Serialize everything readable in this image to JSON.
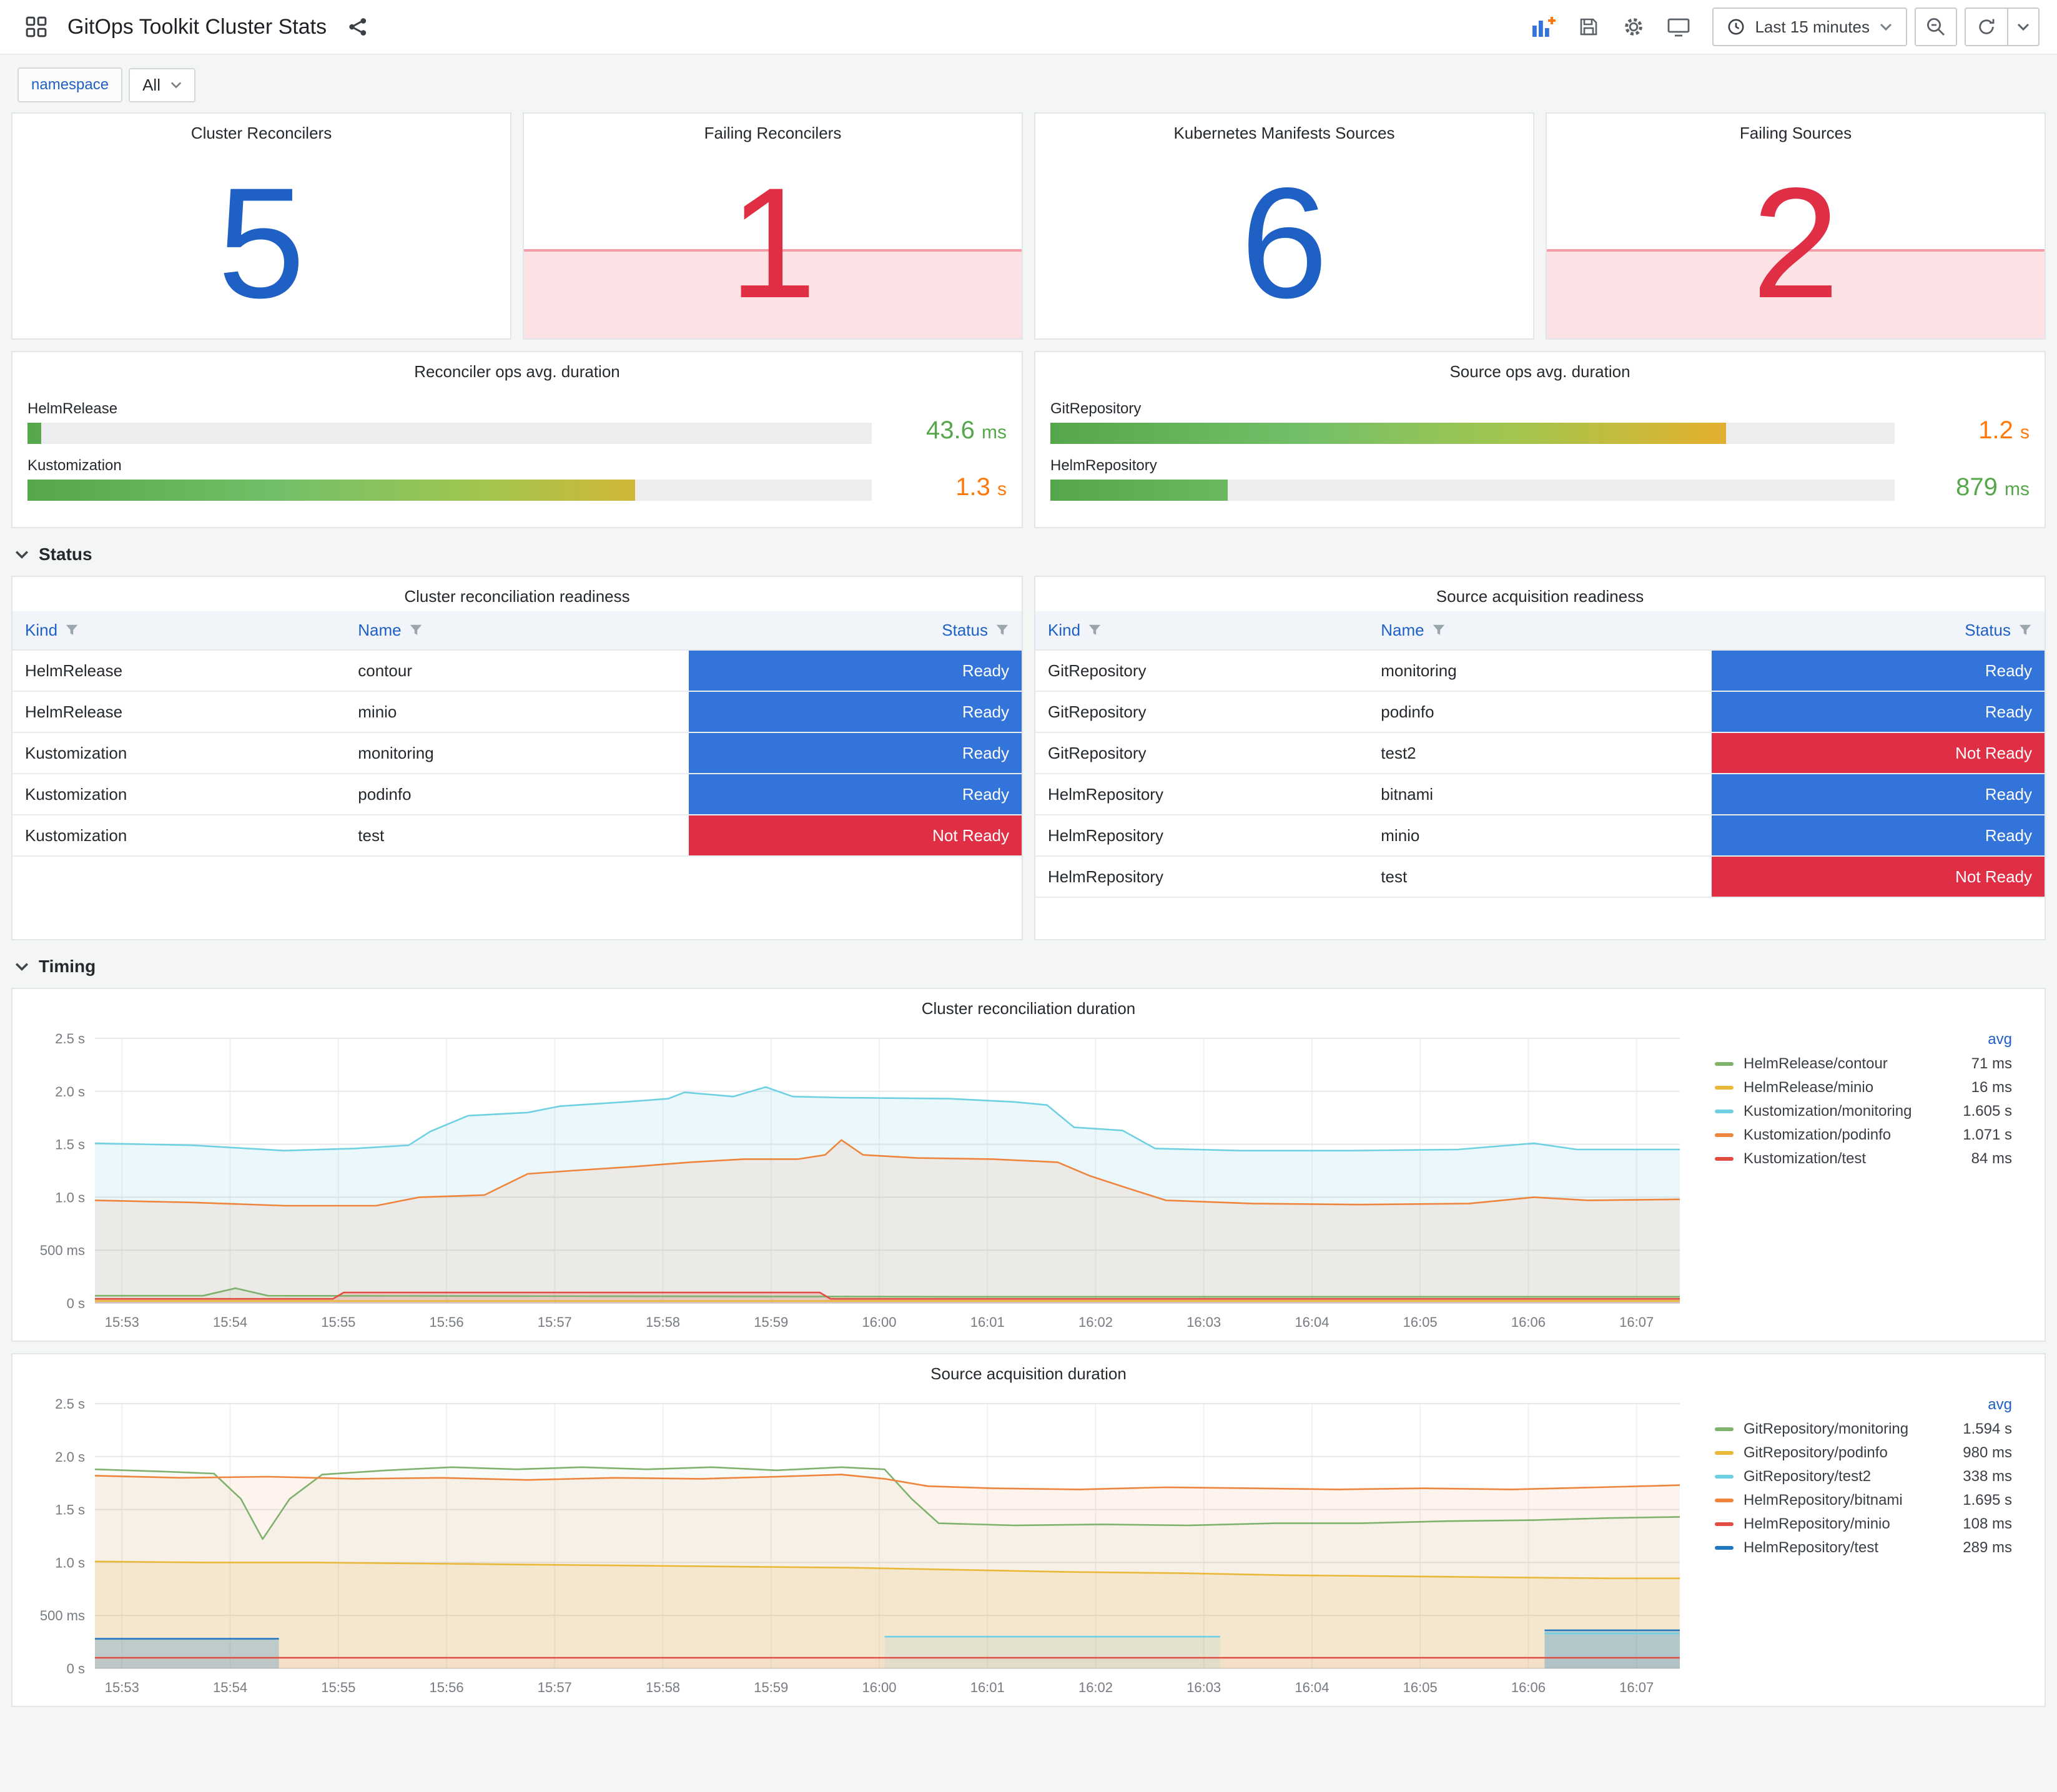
{
  "header": {
    "title": "GitOps Toolkit Cluster Stats",
    "time_range": "Last 15 minutes"
  },
  "variables": {
    "label": "namespace",
    "value": "All"
  },
  "stats": [
    {
      "title": "Cluster Reconcilers",
      "value": "5",
      "color": "#1F60C4"
    },
    {
      "title": "Failing Reconcilers",
      "value": "1",
      "color": "#E02F44",
      "alert": true
    },
    {
      "title": "Kubernetes Manifests Sources",
      "value": "6",
      "color": "#1F60C4"
    },
    {
      "title": "Failing Sources",
      "value": "2",
      "color": "#E02F44",
      "alert": true
    }
  ],
  "gauge_panels": [
    {
      "title": "Reconciler ops avg. duration",
      "rows": [
        {
          "label": "HelmRelease",
          "value": "43.6",
          "unit": "ms",
          "pct": 1.6,
          "value_color": "#56A64B"
        },
        {
          "label": "Kustomization",
          "value": "1.3",
          "unit": "s",
          "pct": 72,
          "value_color": "#FF780A"
        }
      ]
    },
    {
      "title": "Source ops avg. duration",
      "rows": [
        {
          "label": "GitRepository",
          "value": "1.2",
          "unit": "s",
          "pct": 80,
          "value_color": "#FF780A"
        },
        {
          "label": "HelmRepository",
          "value": "879",
          "unit": "ms",
          "pct": 21,
          "value_color": "#56A64B"
        }
      ]
    }
  ],
  "sections": {
    "status": "Status",
    "timing": "Timing"
  },
  "tables": [
    {
      "title": "Cluster reconciliation readiness",
      "columns": [
        "Kind",
        "Name",
        "Status"
      ],
      "rows": [
        {
          "kind": "HelmRelease",
          "name": "contour",
          "status": "Ready",
          "color": "#3274D9"
        },
        {
          "kind": "HelmRelease",
          "name": "minio",
          "status": "Ready",
          "color": "#3274D9"
        },
        {
          "kind": "Kustomization",
          "name": "monitoring",
          "status": "Ready",
          "color": "#3274D9"
        },
        {
          "kind": "Kustomization",
          "name": "podinfo",
          "status": "Ready",
          "color": "#3274D9"
        },
        {
          "kind": "Kustomization",
          "name": "test",
          "status": "Not Ready",
          "color": "#E02F44"
        }
      ]
    },
    {
      "title": "Source acquisition readiness",
      "columns": [
        "Kind",
        "Name",
        "Status"
      ],
      "rows": [
        {
          "kind": "GitRepository",
          "name": "monitoring",
          "status": "Ready",
          "color": "#3274D9"
        },
        {
          "kind": "GitRepository",
          "name": "podinfo",
          "status": "Ready",
          "color": "#3274D9"
        },
        {
          "kind": "GitRepository",
          "name": "test2",
          "status": "Not Ready",
          "color": "#E02F44"
        },
        {
          "kind": "HelmRepository",
          "name": "bitnami",
          "status": "Ready",
          "color": "#3274D9"
        },
        {
          "kind": "HelmRepository",
          "name": "minio",
          "status": "Ready",
          "color": "#3274D9"
        },
        {
          "kind": "HelmRepository",
          "name": "test",
          "status": "Not Ready",
          "color": "#E02F44"
        }
      ]
    }
  ],
  "chart_data": [
    {
      "type": "line",
      "title": "Cluster reconciliation duration",
      "legend_header": "avg",
      "ylim": [
        0,
        2.5
      ],
      "xlim": [
        0,
        14.65
      ],
      "yticks": [
        {
          "v": 0,
          "label": "0 s"
        },
        {
          "v": 0.5,
          "label": "500 ms"
        },
        {
          "v": 1,
          "label": "1.0 s"
        },
        {
          "v": 1.5,
          "label": "1.5 s"
        },
        {
          "v": 2,
          "label": "2.0 s"
        },
        {
          "v": 2.5,
          "label": "2.5 s"
        }
      ],
      "xticks": [
        {
          "v": 0.25,
          "label": "15:53"
        },
        {
          "v": 1.25,
          "label": "15:54"
        },
        {
          "v": 2.25,
          "label": "15:55"
        },
        {
          "v": 3.25,
          "label": "15:56"
        },
        {
          "v": 4.25,
          "label": "15:57"
        },
        {
          "v": 5.25,
          "label": "15:58"
        },
        {
          "v": 6.25,
          "label": "15:59"
        },
        {
          "v": 7.25,
          "label": "16:00"
        },
        {
          "v": 8.25,
          "label": "16:01"
        },
        {
          "v": 9.25,
          "label": "16:02"
        },
        {
          "v": 10.25,
          "label": "16:03"
        },
        {
          "v": 11.25,
          "label": "16:04"
        },
        {
          "v": 12.25,
          "label": "16:05"
        },
        {
          "v": 13.25,
          "label": "16:06"
        },
        {
          "v": 14.25,
          "label": "16:07"
        }
      ],
      "series": [
        {
          "name": "HelmRelease/contour",
          "avg": "71 ms",
          "color": "#7EB26D",
          "fill": 0.07,
          "points": [
            [
              0,
              0.07
            ],
            [
              1.0,
              0.07
            ],
            [
              1.3,
              0.14
            ],
            [
              1.6,
              0.07
            ],
            [
              8,
              0.06
            ],
            [
              14.65,
              0.06
            ]
          ]
        },
        {
          "name": "HelmRelease/minio",
          "avg": "16 ms",
          "color": "#EAB839",
          "fill": 0,
          "points": [
            [
              0,
              0.02
            ],
            [
              14.65,
              0.02
            ]
          ]
        },
        {
          "name": "Kustomization/monitoring",
          "avg": "1.605 s",
          "color": "#6ED0E0",
          "fill": 0.14,
          "points": [
            [
              0,
              1.51
            ],
            [
              0.9,
              1.49
            ],
            [
              1.75,
              1.44
            ],
            [
              2.4,
              1.46
            ],
            [
              2.9,
              1.49
            ],
            [
              3.1,
              1.62
            ],
            [
              3.45,
              1.77
            ],
            [
              4.0,
              1.8
            ],
            [
              4.3,
              1.86
            ],
            [
              4.9,
              1.9
            ],
            [
              5.3,
              1.93
            ],
            [
              5.45,
              1.99
            ],
            [
              5.9,
              1.95
            ],
            [
              6.2,
              2.04
            ],
            [
              6.45,
              1.95
            ],
            [
              6.9,
              1.94
            ],
            [
              7.9,
              1.93
            ],
            [
              8.5,
              1.9
            ],
            [
              8.8,
              1.87
            ],
            [
              9.05,
              1.66
            ],
            [
              9.5,
              1.63
            ],
            [
              9.8,
              1.46
            ],
            [
              10.6,
              1.44
            ],
            [
              11.6,
              1.44
            ],
            [
              12.6,
              1.45
            ],
            [
              13.3,
              1.51
            ],
            [
              13.7,
              1.45
            ],
            [
              14.65,
              1.45
            ]
          ]
        },
        {
          "name": "Kustomization/podinfo",
          "avg": "1.071 s",
          "color": "#EF843C",
          "fill": 0.11,
          "points": [
            [
              0,
              0.97
            ],
            [
              0.9,
              0.95
            ],
            [
              1.75,
              0.92
            ],
            [
              2.6,
              0.92
            ],
            [
              3.0,
              1.0
            ],
            [
              3.6,
              1.02
            ],
            [
              4.0,
              1.22
            ],
            [
              4.4,
              1.25
            ],
            [
              5.0,
              1.29
            ],
            [
              5.5,
              1.33
            ],
            [
              6.0,
              1.36
            ],
            [
              6.5,
              1.36
            ],
            [
              6.75,
              1.4
            ],
            [
              6.9,
              1.54
            ],
            [
              7.1,
              1.4
            ],
            [
              7.6,
              1.37
            ],
            [
              8.3,
              1.36
            ],
            [
              8.9,
              1.33
            ],
            [
              9.2,
              1.2
            ],
            [
              9.5,
              1.1
            ],
            [
              9.9,
              0.97
            ],
            [
              10.7,
              0.94
            ],
            [
              11.7,
              0.93
            ],
            [
              12.7,
              0.94
            ],
            [
              13.3,
              1.0
            ],
            [
              13.8,
              0.97
            ],
            [
              14.65,
              0.98
            ]
          ]
        },
        {
          "name": "Kustomization/test",
          "avg": "84 ms",
          "color": "#E24D42",
          "fill": 0.18,
          "points": [
            [
              0,
              0.04
            ],
            [
              2.2,
              0.04
            ],
            [
              2.3,
              0.1
            ],
            [
              6.7,
              0.1
            ],
            [
              6.8,
              0.04
            ],
            [
              14.65,
              0.04
            ]
          ]
        }
      ]
    },
    {
      "type": "line",
      "title": "Source acquisition duration",
      "legend_header": "avg",
      "ylim": [
        0,
        2.5
      ],
      "xlim": [
        0,
        14.65
      ],
      "yticks": [
        {
          "v": 0,
          "label": "0 s"
        },
        {
          "v": 0.5,
          "label": "500 ms"
        },
        {
          "v": 1,
          "label": "1.0 s"
        },
        {
          "v": 1.5,
          "label": "1.5 s"
        },
        {
          "v": 2,
          "label": "2.0 s"
        },
        {
          "v": 2.5,
          "label": "2.5 s"
        }
      ],
      "xticks": [
        {
          "v": 0.25,
          "label": "15:53"
        },
        {
          "v": 1.25,
          "label": "15:54"
        },
        {
          "v": 2.25,
          "label": "15:55"
        },
        {
          "v": 3.25,
          "label": "15:56"
        },
        {
          "v": 4.25,
          "label": "15:57"
        },
        {
          "v": 5.25,
          "label": "15:58"
        },
        {
          "v": 6.25,
          "label": "15:59"
        },
        {
          "v": 7.25,
          "label": "16:00"
        },
        {
          "v": 8.25,
          "label": "16:01"
        },
        {
          "v": 9.25,
          "label": "16:02"
        },
        {
          "v": 10.25,
          "label": "16:03"
        },
        {
          "v": 11.25,
          "label": "16:04"
        },
        {
          "v": 12.25,
          "label": "16:05"
        },
        {
          "v": 13.25,
          "label": "16:06"
        },
        {
          "v": 14.25,
          "label": "16:07"
        }
      ],
      "series": [
        {
          "name": "GitRepository/monitoring",
          "avg": "1.594 s",
          "color": "#7EB26D",
          "fill": 0.05,
          "points": [
            [
              0,
              1.88
            ],
            [
              0.6,
              1.86
            ],
            [
              1.1,
              1.84
            ],
            [
              1.35,
              1.6
            ],
            [
              1.55,
              1.22
            ],
            [
              1.8,
              1.6
            ],
            [
              2.1,
              1.83
            ],
            [
              2.7,
              1.87
            ],
            [
              3.3,
              1.9
            ],
            [
              3.9,
              1.88
            ],
            [
              4.5,
              1.9
            ],
            [
              5.1,
              1.88
            ],
            [
              5.7,
              1.9
            ],
            [
              6.3,
              1.87
            ],
            [
              6.9,
              1.9
            ],
            [
              7.3,
              1.88
            ],
            [
              7.55,
              1.6
            ],
            [
              7.8,
              1.37
            ],
            [
              8.5,
              1.35
            ],
            [
              9.3,
              1.36
            ],
            [
              10.1,
              1.35
            ],
            [
              10.9,
              1.37
            ],
            [
              11.7,
              1.37
            ],
            [
              12.5,
              1.39
            ],
            [
              13.3,
              1.4
            ],
            [
              14.0,
              1.42
            ],
            [
              14.65,
              1.43
            ]
          ]
        },
        {
          "name": "GitRepository/podinfo",
          "avg": "980 ms",
          "color": "#EAB839",
          "fill": 0.14,
          "points": [
            [
              0,
              1.01
            ],
            [
              1,
              1.0
            ],
            [
              2,
              1.0
            ],
            [
              3,
              0.99
            ],
            [
              4,
              0.98
            ],
            [
              5,
              0.97
            ],
            [
              6,
              0.96
            ],
            [
              7,
              0.95
            ],
            [
              8,
              0.93
            ],
            [
              9,
              0.91
            ],
            [
              10,
              0.9
            ],
            [
              11,
              0.88
            ],
            [
              12,
              0.87
            ],
            [
              13,
              0.86
            ],
            [
              14,
              0.85
            ],
            [
              14.65,
              0.85
            ]
          ]
        },
        {
          "name": "GitRepository/test2",
          "avg": "338 ms",
          "color": "#6ED0E0",
          "fill": 0.15,
          "points": [
            [
              7.3,
              0.3
            ],
            [
              10.4,
              0.3
            ],
            null,
            [
              13.4,
              0.33
            ],
            [
              14.65,
              0.33
            ]
          ]
        },
        {
          "name": "HelmRepository/bitnami",
          "avg": "1.695 s",
          "color": "#EF843C",
          "fill": 0.09,
          "points": [
            [
              0,
              1.82
            ],
            [
              0.8,
              1.8
            ],
            [
              1.6,
              1.81
            ],
            [
              2.4,
              1.79
            ],
            [
              3.2,
              1.8
            ],
            [
              4.0,
              1.78
            ],
            [
              4.8,
              1.8
            ],
            [
              5.6,
              1.79
            ],
            [
              6.3,
              1.81
            ],
            [
              6.9,
              1.83
            ],
            [
              7.3,
              1.79
            ],
            [
              7.7,
              1.72
            ],
            [
              8.3,
              1.7
            ],
            [
              9.1,
              1.69
            ],
            [
              9.9,
              1.71
            ],
            [
              10.7,
              1.7
            ],
            [
              11.5,
              1.69
            ],
            [
              12.3,
              1.7
            ],
            [
              13.1,
              1.69
            ],
            [
              13.9,
              1.71
            ],
            [
              14.65,
              1.73
            ]
          ]
        },
        {
          "name": "HelmRepository/minio",
          "avg": "108 ms",
          "color": "#E24D42",
          "fill": 0.04,
          "points": [
            [
              0,
              0.1
            ],
            [
              14.65,
              0.1
            ]
          ]
        },
        {
          "name": "HelmRepository/test",
          "avg": "289 ms",
          "color": "#1F78C1",
          "fill": 0.25,
          "points": [
            [
              0,
              0.28
            ],
            [
              1.7,
              0.28
            ],
            null,
            [
              13.4,
              0.36
            ],
            [
              14.65,
              0.36
            ]
          ]
        }
      ]
    }
  ]
}
